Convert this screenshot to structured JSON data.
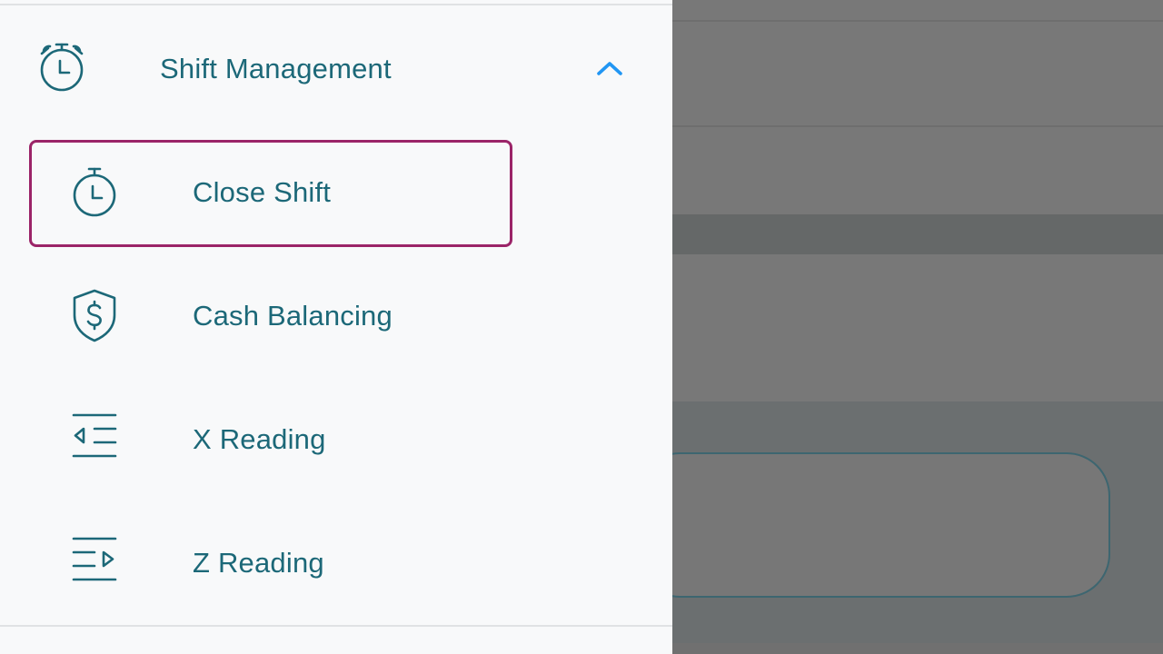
{
  "drawer": {
    "section": {
      "label": "Shift Management",
      "icon": "stopwatch-alarm-icon",
      "expanded": true,
      "chevron_icon": "chevron-up-icon"
    },
    "items": [
      {
        "label": "Close Shift",
        "icon": "stopwatch-icon",
        "selected": true
      },
      {
        "label": "Cash Balancing",
        "icon": "shield-dollar-icon",
        "selected": false
      },
      {
        "label": "X Reading",
        "icon": "list-indent-left-icon",
        "selected": false
      },
      {
        "label": "Z Reading",
        "icon": "list-play-right-icon",
        "selected": false
      }
    ]
  },
  "colors": {
    "text": "#1c6878",
    "accent": "#2196f3",
    "selected_border": "#9b2468",
    "drawer_bg": "#f8f9fa",
    "scrim": "#787878"
  }
}
